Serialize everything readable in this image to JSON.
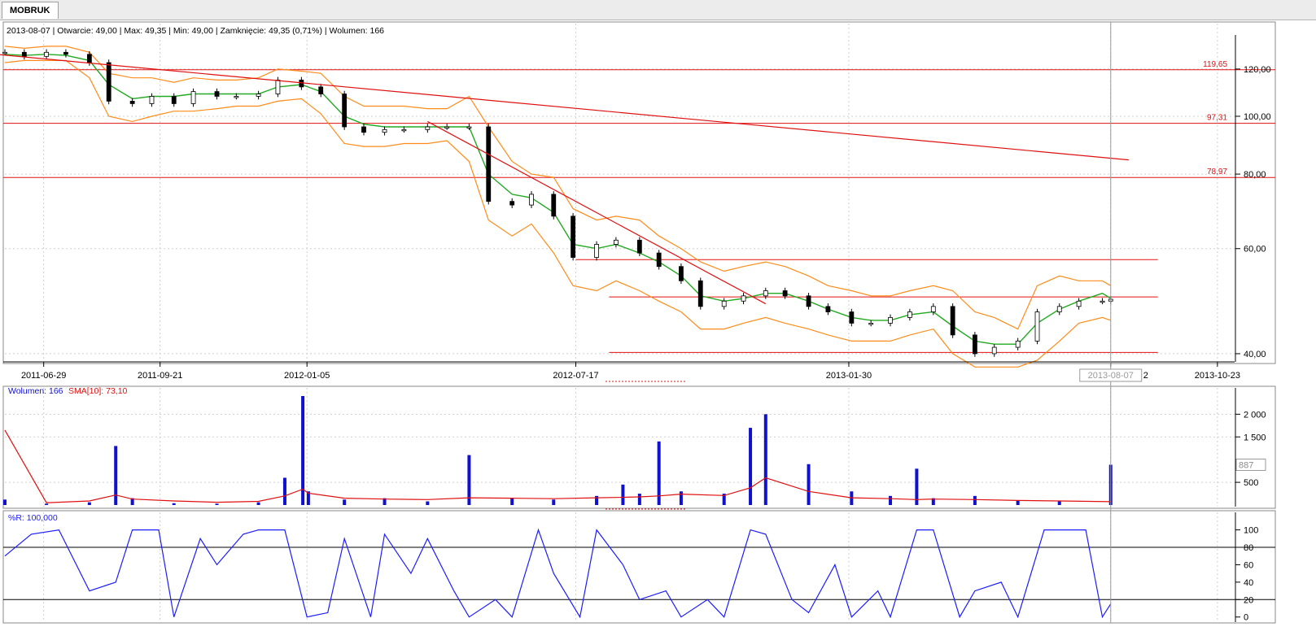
{
  "tab": {
    "label": "MOBRUK"
  },
  "colors": {
    "candle": "#000000",
    "band": "#ff8c1a",
    "sma": "#22aa22",
    "level_line": "#e01010",
    "trend_line": "#e01010",
    "volume_bar": "#1010d0",
    "volume_sma": "#e01010",
    "wr_line": "#1c1cff",
    "grid": "#cfcfcf",
    "cursor": "#9a9a9a"
  },
  "price_panel": {
    "info_line": "2013-08-07 | Otwarcie: 49,00 | Max: 49,35 | Min: 49,00 | Zamknięcie: 49,35 (0,71%) | Wolumen: 166",
    "y_ticks": [
      {
        "value": 40,
        "label": "40,00"
      },
      {
        "value": 60,
        "label": "60,00"
      },
      {
        "value": 80,
        "label": "80,00"
      },
      {
        "value": 100,
        "label": "100,00"
      },
      {
        "value": 120,
        "label": "120,00"
      }
    ],
    "scale": "log",
    "ylim": [
      39,
      136
    ],
    "levels": [
      {
        "value": 119.65,
        "label": "119,65",
        "from": "2011-04-01",
        "to": "2014-01-31"
      },
      {
        "value": 97.31,
        "label": "97,31",
        "from": "2011-04-01",
        "to": "2014-01-31"
      },
      {
        "value": 78.97,
        "label": "78,97",
        "from": "2011-04-01",
        "to": "2014-01-31"
      },
      {
        "value": 57.5,
        "label": "",
        "from": "2012-07-17",
        "to": "2013-09-10"
      },
      {
        "value": 49.8,
        "label": "",
        "from": "2012-08-10",
        "to": "2013-09-10"
      },
      {
        "value": 40.2,
        "label": "",
        "from": "2012-08-10",
        "to": "2013-09-10"
      }
    ],
    "trend_lines": [
      {
        "from": [
          "2011-04-01",
          130.5
        ],
        "to": [
          "2013-08-20",
          84.5
        ]
      },
      {
        "from": [
          "2012-04-01",
          98
        ],
        "to": [
          "2012-12-01",
          48.5
        ]
      }
    ],
    "cursor_date": "2013-08-07",
    "cursor_date_label": "2013-08-07",
    "legend_dash": true
  },
  "x_axis": {
    "start": "2011-06-01",
    "end": "2013-11-05",
    "ticks": [
      {
        "date": "2011-06-29",
        "label": "2011-06-29"
      },
      {
        "date": "2011-09-21",
        "label": "2011-09-21"
      },
      {
        "date": "2012-01-05",
        "label": "2012-01-05"
      },
      {
        "date": "2012-07-17",
        "label": "2012-07-17"
      },
      {
        "date": "2013-01-30",
        "label": "2013-01-30"
      },
      {
        "date": "2013-08-07",
        "label": "2013-08-07"
      },
      {
        "date": "2013-10-23",
        "label": "2013-10-23"
      }
    ],
    "tick_behind_cursor": "2"
  },
  "volume_panel": {
    "legend_label": "Wolumen: 166",
    "sma_label": "SMA[10]: 73,10",
    "y_ticks": [
      {
        "value": 500,
        "label": "500"
      },
      {
        "value": 1500,
        "label": "1 500"
      },
      {
        "value": 2000,
        "label": "2 000"
      }
    ],
    "ylim": [
      0,
      2400
    ],
    "marker_value": 887,
    "marker_label": "887"
  },
  "wr_panel": {
    "legend_label": "%R: 100,000",
    "y_ticks": [
      {
        "value": 0,
        "label": "0"
      },
      {
        "value": 20,
        "label": "20"
      },
      {
        "value": 40,
        "label": "40"
      },
      {
        "value": 60,
        "label": "60"
      },
      {
        "value": 80,
        "label": "80"
      },
      {
        "value": 100,
        "label": "100"
      }
    ],
    "ylim": [
      -4,
      108
    ],
    "levels": [
      20,
      80
    ]
  },
  "chart_data": [
    {
      "type": "candlestick",
      "title": "MOBRUK",
      "x": [
        "2011-06-01",
        "2011-06-15",
        "2011-07-01",
        "2011-07-15",
        "2011-08-01",
        "2011-08-15",
        "2011-09-01",
        "2011-09-15",
        "2011-10-01",
        "2011-10-15",
        "2011-11-01",
        "2011-11-15",
        "2011-12-01",
        "2011-12-15",
        "2012-01-01",
        "2012-01-15",
        "2012-02-01",
        "2012-02-15",
        "2012-03-01",
        "2012-03-15",
        "2012-04-01",
        "2012-04-15",
        "2012-05-01",
        "2012-05-15",
        "2012-06-01",
        "2012-06-15",
        "2012-07-01",
        "2012-07-15",
        "2012-08-01",
        "2012-08-15",
        "2012-09-01",
        "2012-09-15",
        "2012-10-01",
        "2012-10-15",
        "2012-11-01",
        "2012-11-15",
        "2012-12-01",
        "2012-12-15",
        "2013-01-01",
        "2013-01-15",
        "2013-02-01",
        "2013-02-15",
        "2013-03-01",
        "2013-03-15",
        "2013-04-01",
        "2013-04-15",
        "2013-05-01",
        "2013-05-15",
        "2013-06-01",
        "2013-06-15",
        "2013-07-01",
        "2013-07-15",
        "2013-08-01",
        "2013-08-07"
      ],
      "close": [
        128,
        126,
        128,
        127,
        123,
        106,
        105,
        108,
        105,
        110,
        108,
        108,
        109,
        115,
        112,
        109,
        96,
        94,
        95,
        95,
        96,
        96,
        96,
        72,
        71,
        74,
        68,
        58,
        61,
        62,
        59,
        56,
        53,
        48,
        49,
        50,
        51,
        50,
        48,
        47,
        45,
        45,
        46,
        47,
        48,
        43,
        40,
        41,
        42,
        47,
        48,
        49,
        49,
        49.35
      ],
      "sma": [
        127,
        126.5,
        127,
        126.5,
        124,
        113,
        107,
        108,
        108,
        109,
        109,
        109,
        109,
        112,
        113,
        110,
        100,
        97,
        96,
        96,
        96,
        96,
        96,
        80,
        74,
        73,
        69,
        61,
        60,
        61,
        59,
        57,
        54,
        50,
        49,
        49.5,
        50.5,
        50.5,
        49,
        47.5,
        46,
        45.5,
        45.5,
        46.5,
        47,
        44.5,
        42,
        41.5,
        41.5,
        45,
        47.5,
        49,
        50.5,
        49.5
      ],
      "upper": [
        131,
        130,
        131,
        131,
        128,
        118,
        116,
        116,
        114,
        116,
        115,
        115,
        116,
        120,
        119,
        118,
        108,
        104,
        104,
        104,
        103,
        103,
        108,
        96,
        84,
        80,
        79,
        70,
        67,
        68,
        67,
        63,
        60,
        57,
        55,
        56,
        57,
        56,
        54,
        52,
        51,
        50,
        50,
        51,
        52,
        51,
        47,
        46,
        44,
        52,
        54,
        53,
        53,
        52
      ],
      "lower": [
        123,
        124,
        124,
        124,
        116,
        100,
        98,
        100,
        102,
        102,
        103,
        104,
        104,
        106,
        107,
        101,
        90,
        89,
        89,
        90,
        90,
        91,
        84,
        67,
        63,
        66,
        59,
        52,
        51,
        53,
        51,
        49,
        47,
        44,
        44,
        45,
        46,
        45,
        44,
        43,
        42,
        42,
        42,
        43,
        44,
        40,
        38,
        38,
        38,
        39,
        42,
        45,
        46,
        45.5
      ]
    },
    {
      "type": "bar",
      "title": "Wolumen",
      "x": [
        "2011-06-01",
        "2011-07-01",
        "2011-08-01",
        "2011-08-20",
        "2011-09-01",
        "2011-10-01",
        "2011-11-01",
        "2011-12-01",
        "2011-12-20",
        "2012-01-02",
        "2012-01-06",
        "2012-02-01",
        "2012-03-01",
        "2012-04-01",
        "2012-05-01",
        "2012-06-01",
        "2012-07-01",
        "2012-08-01",
        "2012-08-20",
        "2012-09-01",
        "2012-09-15",
        "2012-10-01",
        "2012-11-01",
        "2012-11-20",
        "2012-12-01",
        "2013-01-01",
        "2013-02-01",
        "2013-03-01",
        "2013-03-20",
        "2013-04-01",
        "2013-05-01",
        "2013-06-01",
        "2013-07-01",
        "2013-08-07"
      ],
      "values": [
        120,
        30,
        60,
        1300,
        150,
        40,
        30,
        60,
        600,
        2400,
        300,
        120,
        150,
        80,
        1100,
        150,
        120,
        200,
        450,
        250,
        1400,
        300,
        250,
        1700,
        2000,
        900,
        300,
        200,
        800,
        150,
        200,
        100,
        80,
        887
      ],
      "sma": [
        1650,
        50,
        90,
        220,
        130,
        90,
        60,
        80,
        200,
        350,
        260,
        150,
        130,
        120,
        160,
        150,
        140,
        160,
        170,
        180,
        200,
        240,
        210,
        380,
        600,
        300,
        160,
        140,
        120,
        130,
        120,
        100,
        90,
        73.1
      ],
      "ylabel": "Wolumen",
      "sma_name": "SMA[10]"
    },
    {
      "type": "line",
      "title": "%R",
      "x": [
        "2011-06-01",
        "2011-06-20",
        "2011-07-10",
        "2011-08-01",
        "2011-08-20",
        "2011-09-01",
        "2011-09-20",
        "2011-10-01",
        "2011-10-20",
        "2011-11-01",
        "2011-11-20",
        "2011-12-01",
        "2011-12-20",
        "2012-01-05",
        "2012-01-20",
        "2012-02-01",
        "2012-02-20",
        "2012-03-01",
        "2012-03-20",
        "2012-04-01",
        "2012-04-20",
        "2012-05-01",
        "2012-05-20",
        "2012-06-01",
        "2012-06-20",
        "2012-07-01",
        "2012-07-20",
        "2012-08-01",
        "2012-08-20",
        "2012-09-01",
        "2012-09-20",
        "2012-10-01",
        "2012-10-20",
        "2012-11-01",
        "2012-11-20",
        "2012-12-01",
        "2012-12-20",
        "2013-01-01",
        "2013-01-20",
        "2013-02-01",
        "2013-02-20",
        "2013-03-01",
        "2013-03-20",
        "2013-04-01",
        "2013-04-20",
        "2013-05-01",
        "2013-05-20",
        "2013-06-01",
        "2013-06-20",
        "2013-07-01",
        "2013-07-20",
        "2013-08-01",
        "2013-08-07"
      ],
      "values": [
        70,
        95,
        100,
        30,
        40,
        100,
        100,
        0,
        90,
        60,
        95,
        100,
        100,
        0,
        5,
        90,
        0,
        95,
        50,
        90,
        30,
        0,
        20,
        0,
        100,
        50,
        0,
        100,
        60,
        20,
        30,
        0,
        20,
        0,
        100,
        95,
        20,
        5,
        60,
        0,
        30,
        0,
        100,
        100,
        0,
        30,
        40,
        0,
        100,
        100,
        100,
        0,
        15
      ],
      "ylim": [
        0,
        100
      ]
    }
  ]
}
